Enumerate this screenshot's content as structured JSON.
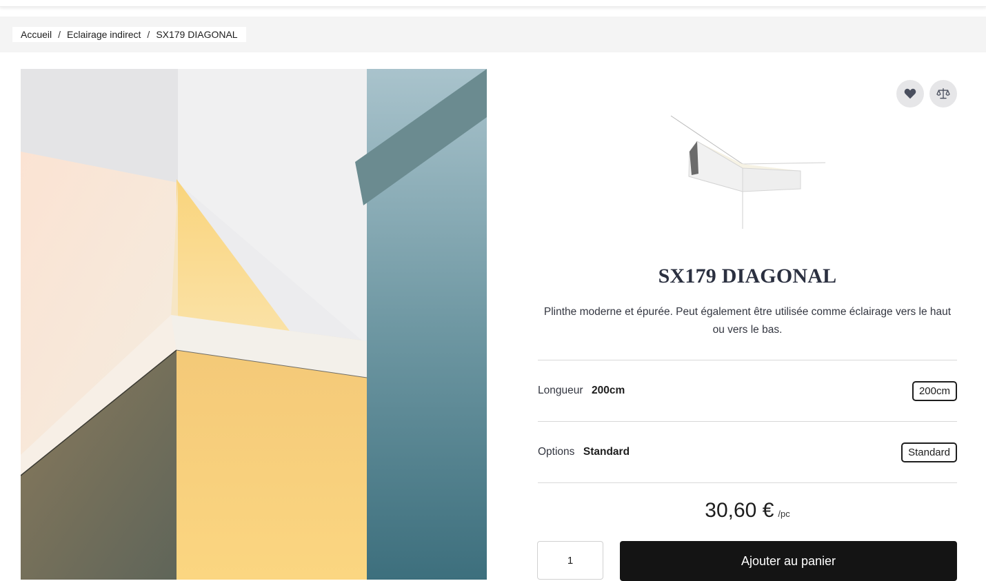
{
  "breadcrumb": {
    "items": [
      "Accueil",
      "Eclairage indirect",
      "SX179 DIAGONAL"
    ],
    "separator": "/"
  },
  "product": {
    "title": "SX179 DIAGONAL",
    "description": "Plinthe moderne et épurée. Peut également être utilisée comme éclairage vers le haut ou vers le bas.",
    "options": [
      {
        "label": "Longueur",
        "selected": "200cm",
        "chip": "200cm"
      },
      {
        "label": "Options",
        "selected": "Standard",
        "chip": "Standard"
      }
    ],
    "price": {
      "amount": "30,60 €",
      "unit": "/pc"
    },
    "quantity": "1",
    "add_to_cart_label": "Ajouter au panier"
  },
  "icons": {
    "wishlist": "heart-icon",
    "compare": "scale-icon"
  },
  "colors": {
    "button_bg": "#141414",
    "icon_bg": "#e6e6e8",
    "breadcrumb_bg": "#f4f4f4"
  }
}
